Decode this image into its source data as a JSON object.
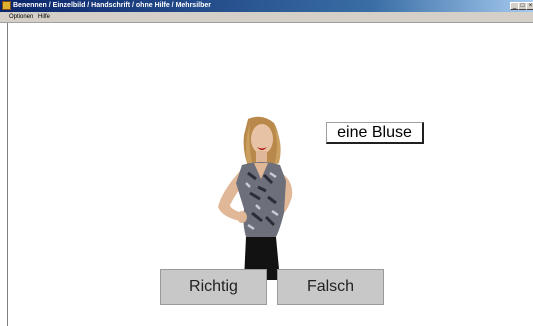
{
  "window": {
    "title": "Benennen / Einzelbild / Handschrift / ohne Hilfe / Mehrsilber",
    "controls": {
      "minimize": "_",
      "maximize": "□",
      "close": "×"
    }
  },
  "menu": {
    "items": [
      "Optionen",
      "Hilfe"
    ]
  },
  "exercise": {
    "word": "eine Bluse",
    "image": "woman-in-blouse-photo"
  },
  "buttons": {
    "correct": "Richtig",
    "wrong": "Falsch"
  },
  "colors": {
    "titlebar": "#0a246a",
    "button_bg": "#c8c8c8"
  }
}
